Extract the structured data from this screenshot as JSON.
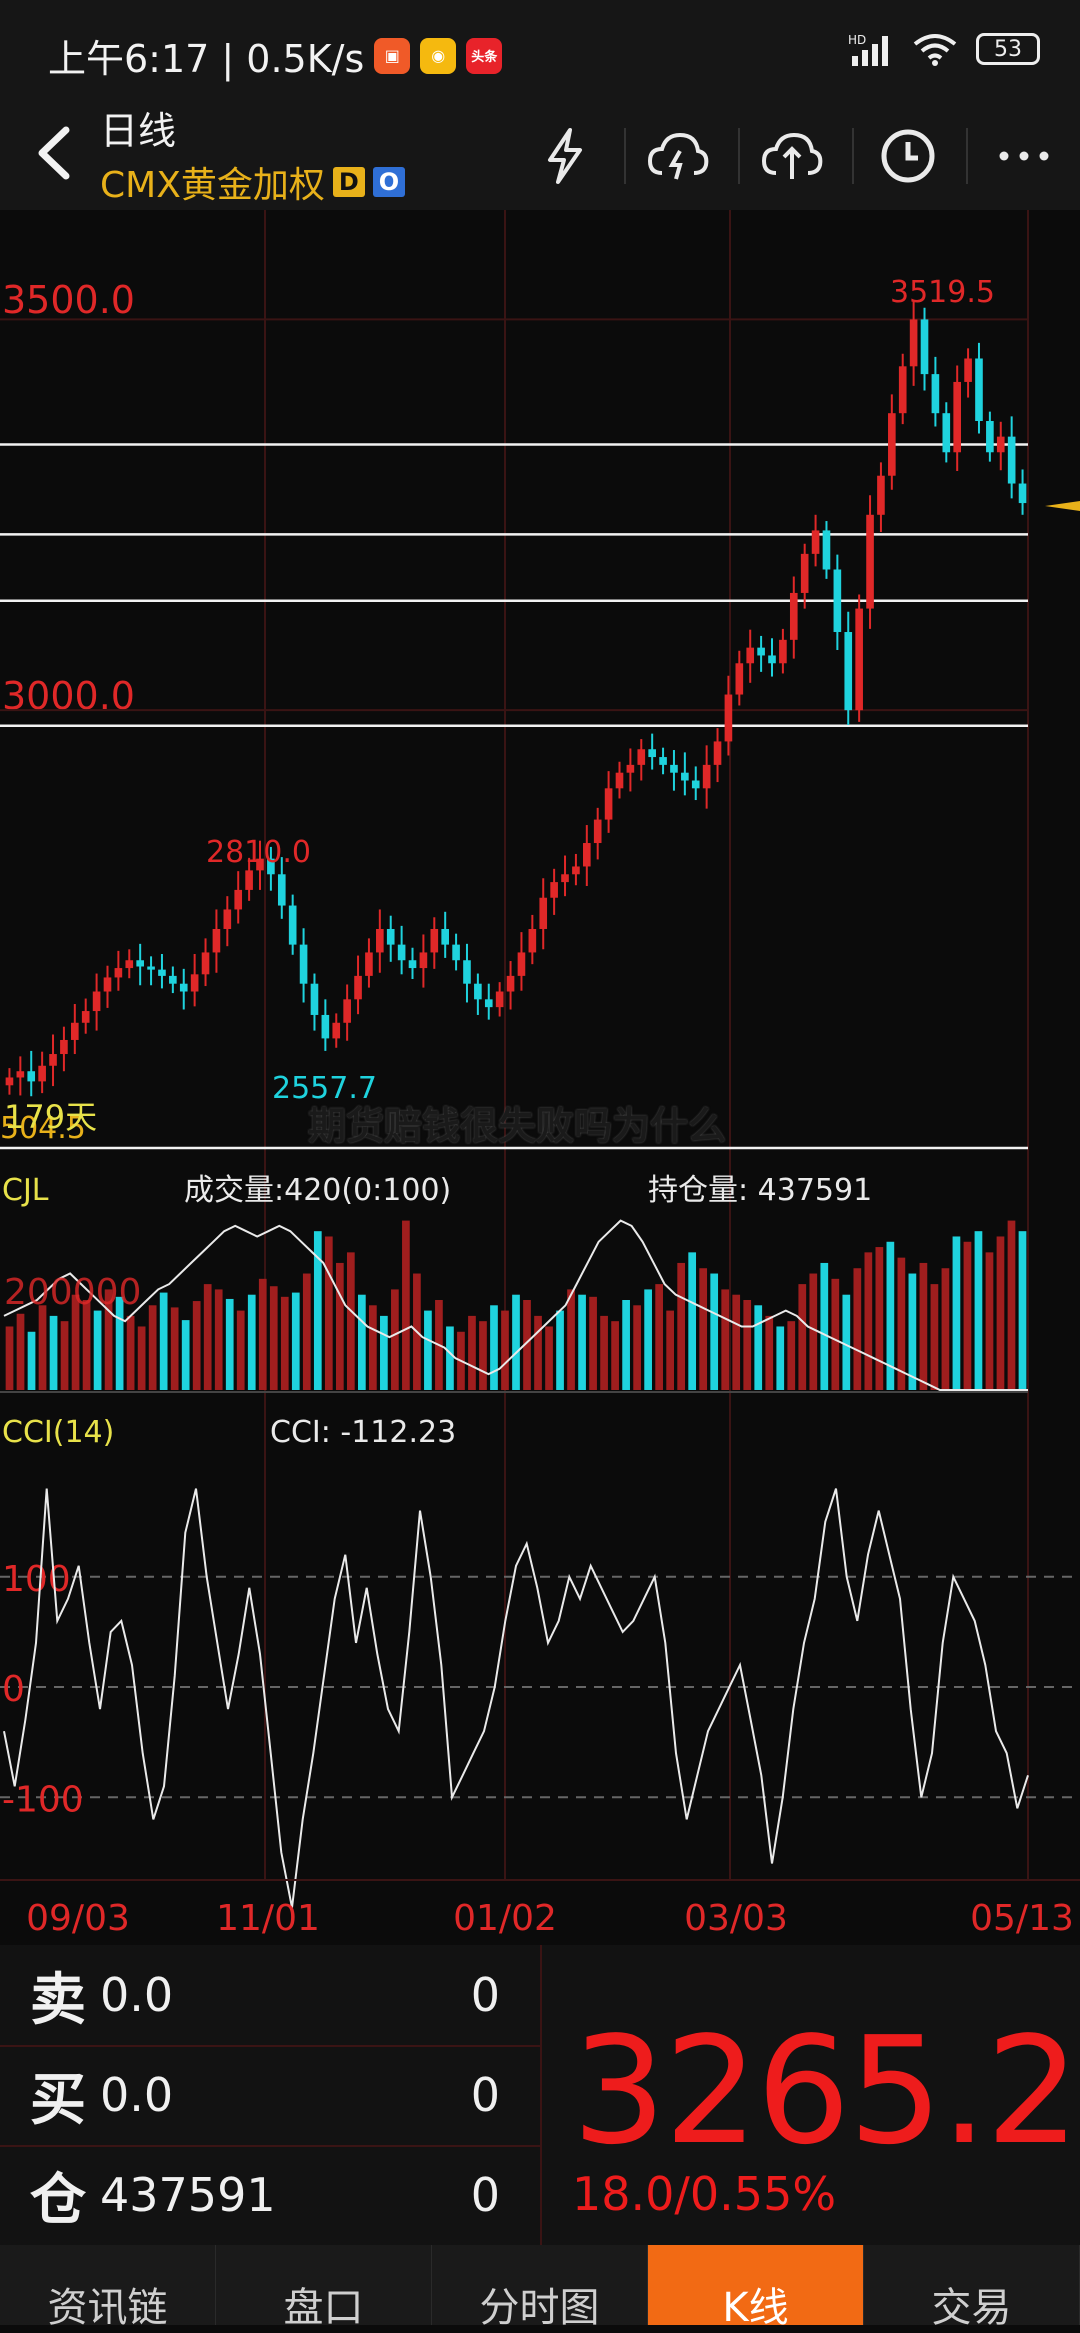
{
  "status": {
    "time_speed": "上午6:17 | 0.5K/s",
    "apps": [
      {
        "name": "app-icon-orange",
        "color": "#f05a28",
        "glyph": "▣"
      },
      {
        "name": "weibo-icon",
        "color": "#f5b90f",
        "glyph": "◉"
      },
      {
        "name": "toutiao-icon",
        "color": "#e8232a",
        "glyph": "头条"
      }
    ],
    "network": "HD",
    "battery": "53"
  },
  "header": {
    "title": "日线",
    "instrument": "CMX黄金加权",
    "badge_d": "D",
    "badge_o": "O",
    "icons": [
      "lightning-icon",
      "cloud-upload-icon",
      "cloud-download-icon",
      "clock-icon",
      "more-icon"
    ]
  },
  "chart_data": {
    "type": "candlestick",
    "price_panel": {
      "y_ticks": [
        {
          "value": 3500,
          "label": "3500.0"
        },
        {
          "value": 3000,
          "label": "3000.0"
        }
      ],
      "ylim": [
        2450,
        3640
      ],
      "high_label": "3519.5",
      "marker_2810": "2810.0",
      "marker_2557": "2557.7",
      "days_label": "179天",
      "left_cut_label": "504.5",
      "horizontal_lines": [
        3340,
        3225,
        3140,
        2980
      ],
      "close_series": [
        2530,
        2538,
        2525,
        2545,
        2560,
        2578,
        2600,
        2615,
        2640,
        2658,
        2670,
        2680,
        2672,
        2668,
        2660,
        2650,
        2640,
        2662,
        2690,
        2720,
        2745,
        2770,
        2795,
        2810,
        2790,
        2750,
        2700,
        2650,
        2610,
        2580,
        2600,
        2630,
        2660,
        2690,
        2720,
        2700,
        2680,
        2670,
        2690,
        2720,
        2700,
        2680,
        2650,
        2630,
        2620,
        2640,
        2660,
        2690,
        2720,
        2760,
        2780,
        2790,
        2800,
        2830,
        2860,
        2900,
        2920,
        2930,
        2950,
        2940,
        2930,
        2920,
        2910,
        2900,
        2930,
        2960,
        3020,
        3060,
        3080,
        3070,
        3060,
        3090,
        3150,
        3200,
        3230,
        3180,
        3100,
        3000,
        3130,
        3250,
        3300,
        3380,
        3440,
        3500,
        3430,
        3380,
        3330,
        3420,
        3450,
        3370,
        3330,
        3350,
        3290,
        3265
      ]
    },
    "volume_panel": {
      "name": "CJL",
      "volume_label": "成交量:420(0:100)",
      "oi_label": "持仓量: 437591",
      "tick_label": "200000",
      "bars": [
        60,
        72,
        55,
        80,
        70,
        65,
        90,
        85,
        75,
        95,
        88,
        70,
        60,
        80,
        92,
        78,
        66,
        84,
        100,
        95,
        86,
        75,
        90,
        105,
        98,
        88,
        92,
        110,
        150,
        145,
        120,
        130,
        90,
        80,
        70,
        95,
        160,
        110,
        75,
        85,
        60,
        55,
        70,
        65,
        80,
        75,
        90,
        85,
        70,
        60,
        75,
        95,
        90,
        88,
        70,
        65,
        85,
        80,
        95,
        100,
        75,
        120,
        130,
        115,
        110,
        95,
        90,
        85,
        80,
        70,
        60,
        65,
        100,
        110,
        120,
        105,
        90,
        115,
        130,
        135,
        140,
        125,
        110,
        120,
        100,
        115,
        145,
        140,
        150,
        130,
        145,
        160,
        150
      ],
      "oi_line": [
        70,
        75,
        80,
        85,
        95,
        105,
        110,
        100,
        90,
        80,
        70,
        65,
        75,
        85,
        95,
        100,
        110,
        120,
        130,
        140,
        150,
        155,
        150,
        145,
        150,
        155,
        150,
        140,
        130,
        120,
        100,
        80,
        70,
        60,
        55,
        50,
        55,
        60,
        50,
        45,
        40,
        30,
        25,
        20,
        15,
        20,
        30,
        40,
        50,
        60,
        70,
        80,
        100,
        120,
        140,
        150,
        160,
        155,
        140,
        120,
        100,
        90,
        85,
        80,
        75,
        70,
        65,
        60,
        60,
        65,
        70,
        75,
        70,
        60,
        55,
        50,
        45,
        40,
        35,
        30,
        25,
        20,
        15,
        10,
        5,
        0,
        0,
        0,
        0,
        0,
        0,
        0,
        0,
        0
      ]
    },
    "cci_panel": {
      "name": "CCI(14)",
      "value_label": "CCI: -112.23",
      "levels": [
        {
          "value": 100,
          "label": "100"
        },
        {
          "value": 0,
          "label": "0"
        },
        {
          "value": -100,
          "label": "-100"
        }
      ],
      "ylim": [
        -175,
        215
      ],
      "series": [
        -40,
        -90,
        -30,
        40,
        180,
        60,
        80,
        110,
        40,
        -20,
        50,
        60,
        20,
        -60,
        -120,
        -90,
        10,
        140,
        180,
        100,
        40,
        -20,
        30,
        90,
        30,
        -60,
        -150,
        -200,
        -120,
        -60,
        10,
        80,
        120,
        40,
        90,
        30,
        -20,
        -40,
        50,
        160,
        100,
        20,
        -100,
        -80,
        -60,
        -40,
        0,
        60,
        110,
        130,
        90,
        40,
        60,
        100,
        80,
        110,
        90,
        70,
        50,
        60,
        80,
        100,
        40,
        -60,
        -120,
        -80,
        -40,
        -20,
        0,
        20,
        -30,
        -80,
        -160,
        -100,
        -20,
        40,
        80,
        150,
        180,
        100,
        60,
        120,
        160,
        120,
        80,
        -20,
        -100,
        -60,
        40,
        100,
        80,
        60,
        20,
        -40,
        -60,
        -110,
        -80
      ]
    },
    "x_axis": [
      "09/03",
      "11/01",
      "01/02",
      "03/03",
      "05/13"
    ]
  },
  "watermark": "期货赔钱很失败吗为什么",
  "orderbook": {
    "sell": {
      "label": "卖",
      "price": "0.0",
      "qty": "0"
    },
    "buy": {
      "label": "买",
      "price": "0.0",
      "qty": "0"
    },
    "position": {
      "label": "仓",
      "price": "437591",
      "qty": "0"
    }
  },
  "quote": {
    "last": "3265.2",
    "change": "18.0/0.55%"
  },
  "tabs": [
    {
      "label": "资讯链",
      "active": false
    },
    {
      "label": "盘口",
      "active": false
    },
    {
      "label": "分时图",
      "active": false
    },
    {
      "label": "K线",
      "active": true
    },
    {
      "label": "交易",
      "active": false
    }
  ],
  "colors": {
    "up": "#e02828",
    "down": "#1fd3de",
    "accent": "#f26a14",
    "gold": "#e8b11a"
  }
}
